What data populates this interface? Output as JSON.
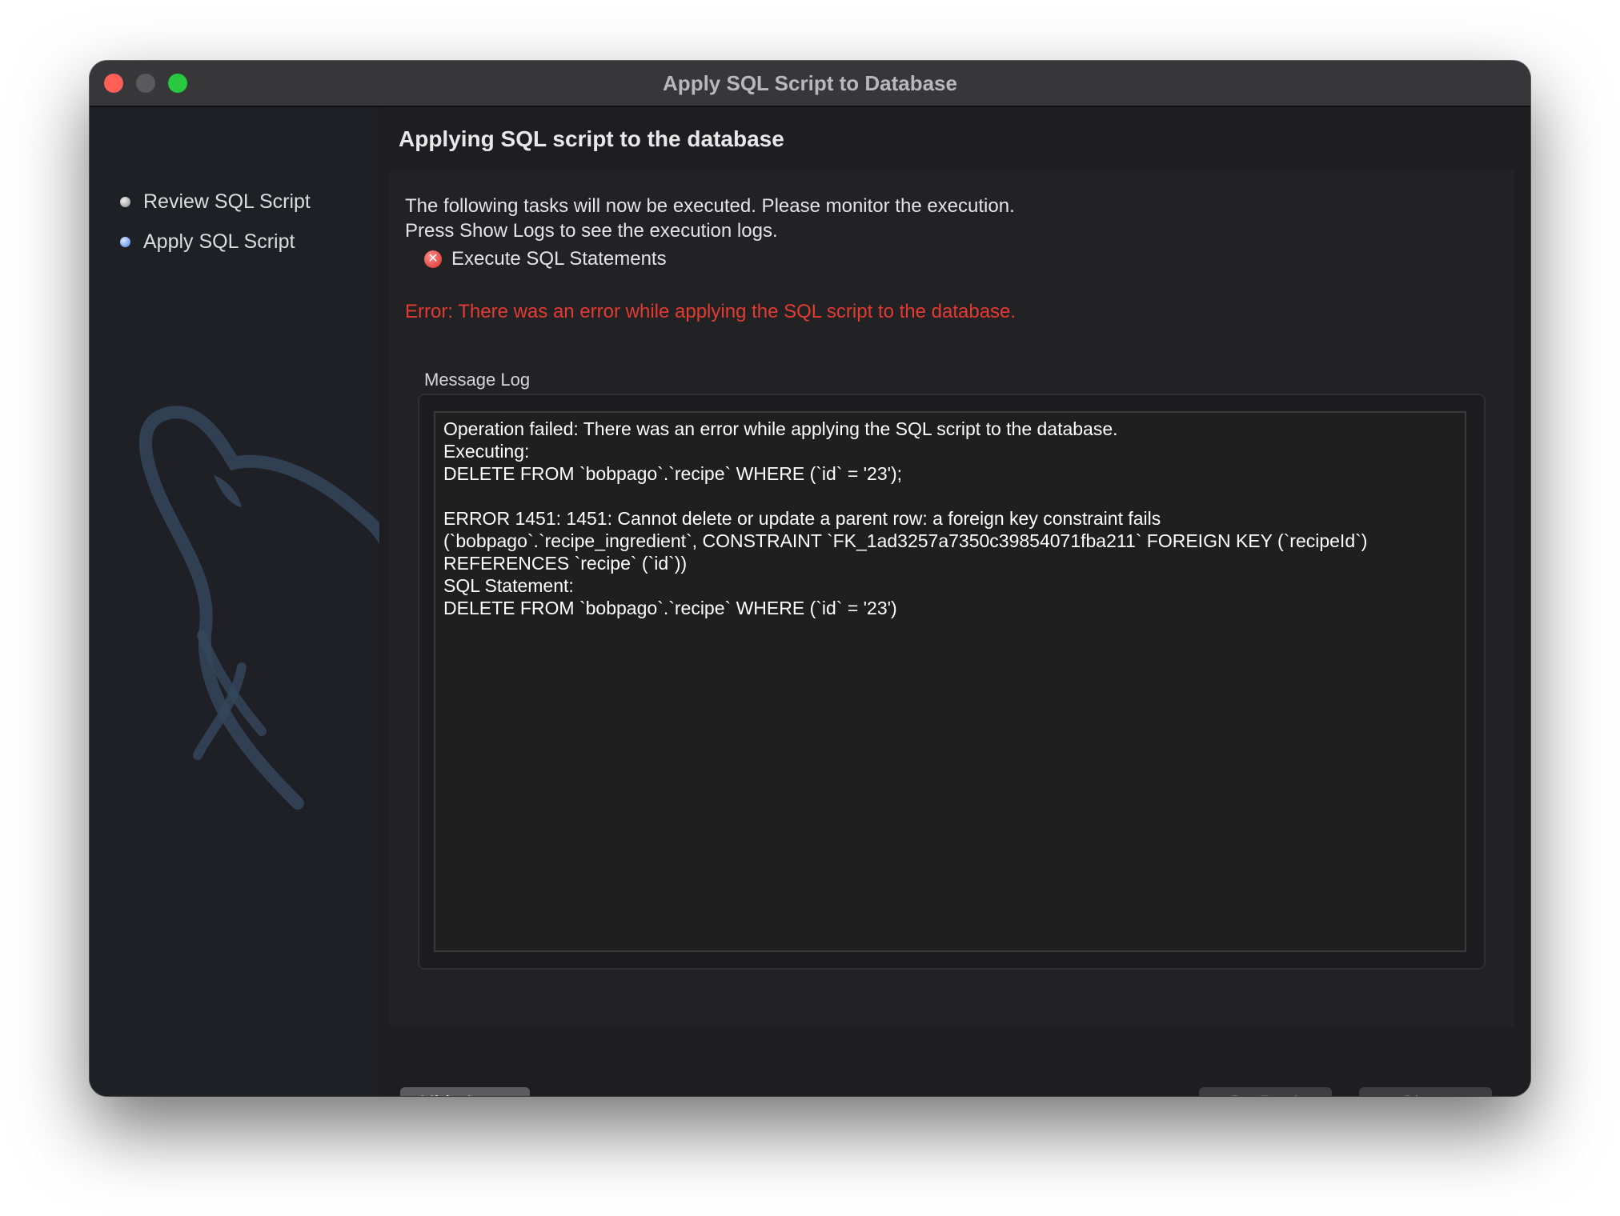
{
  "window": {
    "title": "Apply SQL Script to Database"
  },
  "sidebar": {
    "steps": [
      {
        "label": "Review SQL Script",
        "state": "completed"
      },
      {
        "label": "Apply SQL Script",
        "state": "current"
      }
    ]
  },
  "main": {
    "title": "Applying SQL script to the database",
    "intro_line1": "The following tasks will now be executed. Please monitor the execution.",
    "intro_line2": "Press Show Logs to see the execution logs.",
    "task": {
      "label": "Execute SQL Statements",
      "status": "error"
    },
    "error_message": "Error: There was an error while applying the SQL script to the database.",
    "log": {
      "title": "Message Log",
      "lines": [
        "Operation failed: There was an error while applying the SQL script to the database.",
        "Executing:",
        "DELETE FROM `bobpago`.`recipe` WHERE (`id` = '23');",
        "",
        "ERROR 1451: 1451: Cannot delete or update a parent row: a foreign key constraint fails",
        "(`bobpago`.`recipe_ingredient`, CONSTRAINT `FK_1ad3257a7350c39854071fba211` FOREIGN KEY (`recipeId`)",
        "REFERENCES `recipe` (`id`))",
        "SQL Statement:",
        "DELETE FROM `bobpago`.`recipe` WHERE (`id` = '23')"
      ]
    }
  },
  "buttons": {
    "hide_logs": "Hide Logs",
    "go_back": "Go Back",
    "close": "Close"
  },
  "colors": {
    "error": "#e33b32",
    "window_bg": "#1e1e20",
    "titlebar": "#37373a"
  }
}
